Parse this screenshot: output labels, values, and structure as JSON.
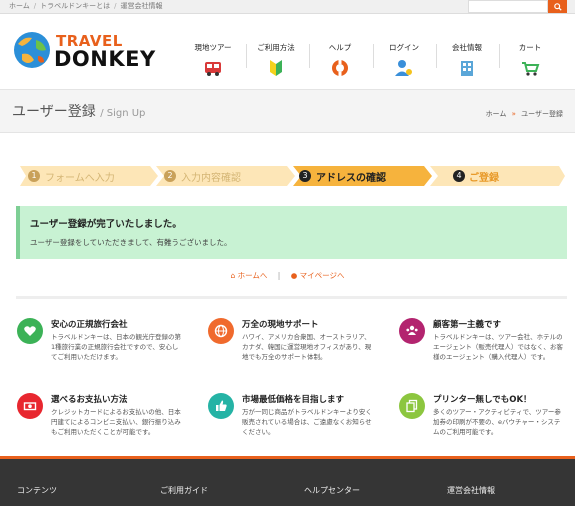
{
  "topbar": {
    "breadcrumbs": [
      "ホーム",
      "トラベルドンキーとは",
      "運営会社情報"
    ],
    "separator": "/"
  },
  "logo": {
    "line1": "TRAVEL",
    "line2": "DONKEY"
  },
  "nav": [
    {
      "label": "現地ツアー",
      "icon": "bus-icon"
    },
    {
      "label": "ご利用方法",
      "icon": "beginner-mark-icon"
    },
    {
      "label": "ヘルプ",
      "icon": "lifebuoy-icon"
    },
    {
      "label": "ログイン",
      "icon": "user-key-icon"
    },
    {
      "label": "会社情報",
      "icon": "building-icon"
    },
    {
      "label": "カート",
      "icon": "cart-icon"
    }
  ],
  "page": {
    "title": "ユーザー登録",
    "subtitle": "/ Sign Up"
  },
  "page_crumb": {
    "home": "ホーム",
    "arrow": "»",
    "current": "ユーザー登録"
  },
  "steps": [
    {
      "num": "1",
      "label": "フォームへ入力",
      "state": "inactive"
    },
    {
      "num": "2",
      "label": "入力内容確認",
      "state": "inactive"
    },
    {
      "num": "3",
      "label": "アドレスの確認",
      "state": "active"
    },
    {
      "num": "4",
      "label": "ご登録",
      "state": "pending"
    }
  ],
  "alert": {
    "title": "ユーザー登録が完了いたしました。",
    "message": "ユーザー登録をしていただきまして、有難うございました。"
  },
  "links": {
    "home": "ホームへ",
    "separator": "|",
    "mypage": "マイページへ"
  },
  "features": [
    {
      "title": "安心の正規旅行会社",
      "text": "トラベルドンキーは、日本の観光庁登録の第1種旅行業の正規旅行会社ですので、安心してご利用いただけます。",
      "color": "#3cb257",
      "icon": "heart-icon"
    },
    {
      "title": "万全の現地サポート",
      "text": "ハワイ、アメリカ合衆国、オーストラリア、カナダ、韓国に運営現地オフィスがあり、現地でも万全のサポート体制。",
      "color": "#f06a2d",
      "icon": "globe-icon"
    },
    {
      "title": "顧客第一主義です",
      "text": "トラベルドンキーは、ツアー会社、ホテルのエージェント（販売代理人）ではなく、お客様のエージェント（購入代理人）です。",
      "color": "#b3246f",
      "icon": "users-icon"
    },
    {
      "title": "選べるお支払い方法",
      "text": "クレジットカードによるお支払いの他、日本円建てによるコンビニ支払い、銀行振り込みもご利用いただくことが可能です。",
      "color": "#e8272f",
      "icon": "money-icon"
    },
    {
      "title": "市場最低価格を目指します",
      "text": "万が一同じ商品がトラベルドンキーより安く販売されている場合は、ご遠慮なくお知らせください。",
      "color": "#25b3a5",
      "icon": "thumbs-up-icon"
    },
    {
      "title": "プリンター無しでもOK！",
      "text": "多くのツアー・アクティビティで、ツアー参加券の印刷が不要の、eバウチャー・システムのご利用可能です。",
      "color": "#8cc63f",
      "icon": "copy-icon"
    }
  ],
  "footer": [
    "コンテンツ",
    "ご利用ガイド",
    "ヘルプセンター",
    "運営会社情報"
  ],
  "colors": {
    "accent": "#e8601c",
    "step_active": "#f6b33d",
    "step_inactive": "#fde6b7",
    "alert_bg": "#c8f2d3",
    "footer_bg": "#353535"
  }
}
